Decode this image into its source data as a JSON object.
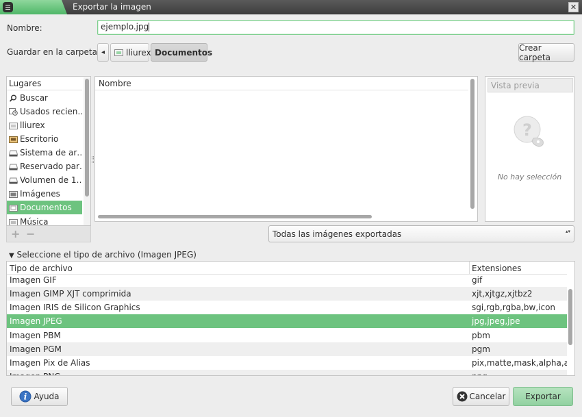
{
  "window": {
    "title": "Exportar la imagen",
    "close_glyph": "✕"
  },
  "form": {
    "name_label": "Nombre:",
    "name_value": "ejemplo.jpg",
    "folder_label": "Guardar en la carpeta:",
    "path_back_glyph": "◂",
    "path": [
      "lliurex",
      "Documentos"
    ],
    "create_folder": "Crear carpeta"
  },
  "places": {
    "header": "Lugares",
    "items": [
      {
        "label": "Buscar",
        "icon": "search-icon"
      },
      {
        "label": "Usados recien…",
        "icon": "recent-icon"
      },
      {
        "label": "lliurex",
        "icon": "home-folder-icon"
      },
      {
        "label": "Escritorio",
        "icon": "desktop-folder-icon"
      },
      {
        "label": "Sistema de ar…",
        "icon": "drive-icon"
      },
      {
        "label": "Reservado par…",
        "icon": "drive-icon"
      },
      {
        "label": "Volumen de 1…",
        "icon": "drive-icon"
      },
      {
        "label": "Imágenes",
        "icon": "pictures-folder-icon"
      },
      {
        "label": "Documentos",
        "icon": "documents-folder-icon",
        "selected": true
      },
      {
        "label": "Música",
        "icon": "music-folder-icon"
      }
    ],
    "add_glyph": "+",
    "remove_glyph": "−"
  },
  "files": {
    "column_name": "Nombre"
  },
  "preview": {
    "header": "Vista previa",
    "empty_text": "No hay selección"
  },
  "filter": {
    "selected": "Todas las imágenes exportadas",
    "arrows": "▴▾"
  },
  "filetype": {
    "expander": "Seleccione el tipo de archivo (Imagen JPEG)",
    "col_type": "Tipo de archivo",
    "col_ext": "Extensiones",
    "rows": [
      {
        "type": "Imagen GIF",
        "ext": "gif"
      },
      {
        "type": "Imagen GIMP XJT comprimida",
        "ext": "xjt,xjtgz,xjtbz2"
      },
      {
        "type": "Imagen IRIS de Silicon Graphics",
        "ext": "sgi,rgb,rgba,bw,icon"
      },
      {
        "type": "Imagen JPEG",
        "ext": "jpg,jpeg,jpe",
        "selected": true
      },
      {
        "type": "Imagen PBM",
        "ext": "pbm"
      },
      {
        "type": "Imagen PGM",
        "ext": "pgm"
      },
      {
        "type": "Imagen Pix de Alias",
        "ext": "pix,matte,mask,alpha,als"
      },
      {
        "type": "Imagen PNG",
        "ext": "png"
      }
    ]
  },
  "buttons": {
    "help": "Ayuda",
    "cancel": "Cancelar",
    "export": "Exportar"
  },
  "colors": {
    "accent": "#6dc37f",
    "titlebar": "#4a4a4a"
  }
}
